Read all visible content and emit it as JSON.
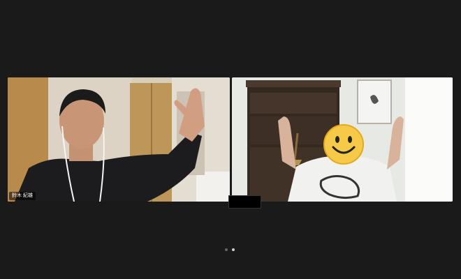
{
  "participants": [
    {
      "name": "鈴木 紀雄",
      "active_speaker": false
    },
    {
      "name": "",
      "active_speaker": true
    }
  ],
  "pagination": {
    "pages": 2,
    "current": 2
  },
  "colors": {
    "background": "#1a1a1a",
    "active_speaker_border": "#23d959"
  }
}
